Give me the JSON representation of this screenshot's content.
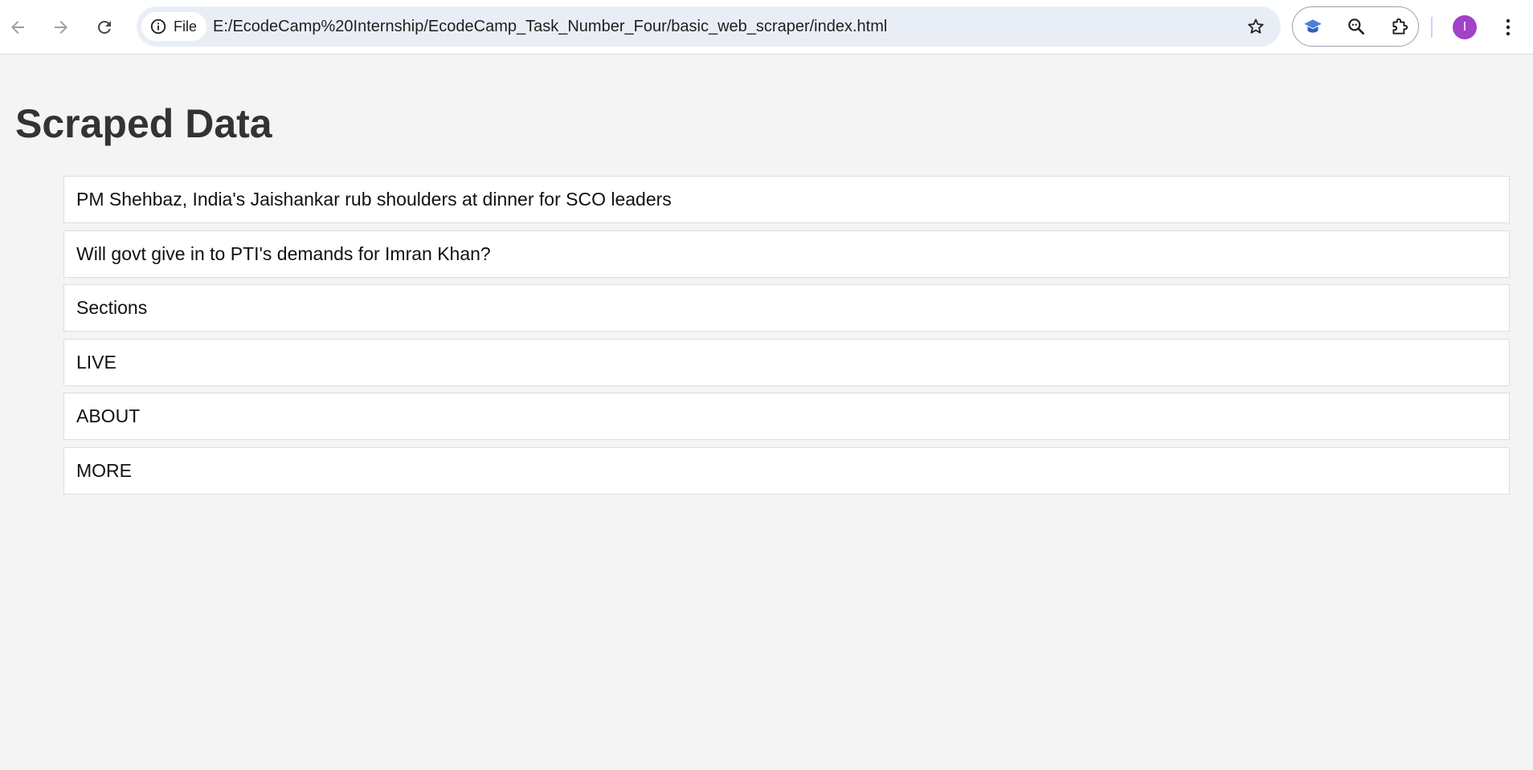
{
  "browser": {
    "site_chip_label": "File",
    "url": "E:/EcodeCamp%20Internship/EcodeCamp_Task_Number_Four/basic_web_scraper/index.html",
    "profile_initial": "I",
    "icons": {
      "back": "arrow-left-icon",
      "forward": "arrow-right-icon",
      "reload": "reload-icon",
      "site_info": "info-icon",
      "bookmark": "star-icon",
      "extension_1": "graduation-cap-icon",
      "extension_2": "search-zoom-icon",
      "extensions_menu": "puzzle-icon",
      "menu": "kebab-menu-icon"
    },
    "colors": {
      "omnibox_bg": "#e9eef6",
      "avatar_bg": "#a142c8",
      "extension_accent": "#4a7fe0"
    }
  },
  "page": {
    "title": "Scraped Data",
    "items": [
      "PM Shehbaz, India's Jaishankar rub shoulders at dinner for SCO leaders",
      "Will govt give in to PTI's demands for Imran Khan?",
      "Sections",
      "LIVE",
      "ABOUT",
      "MORE"
    ]
  }
}
